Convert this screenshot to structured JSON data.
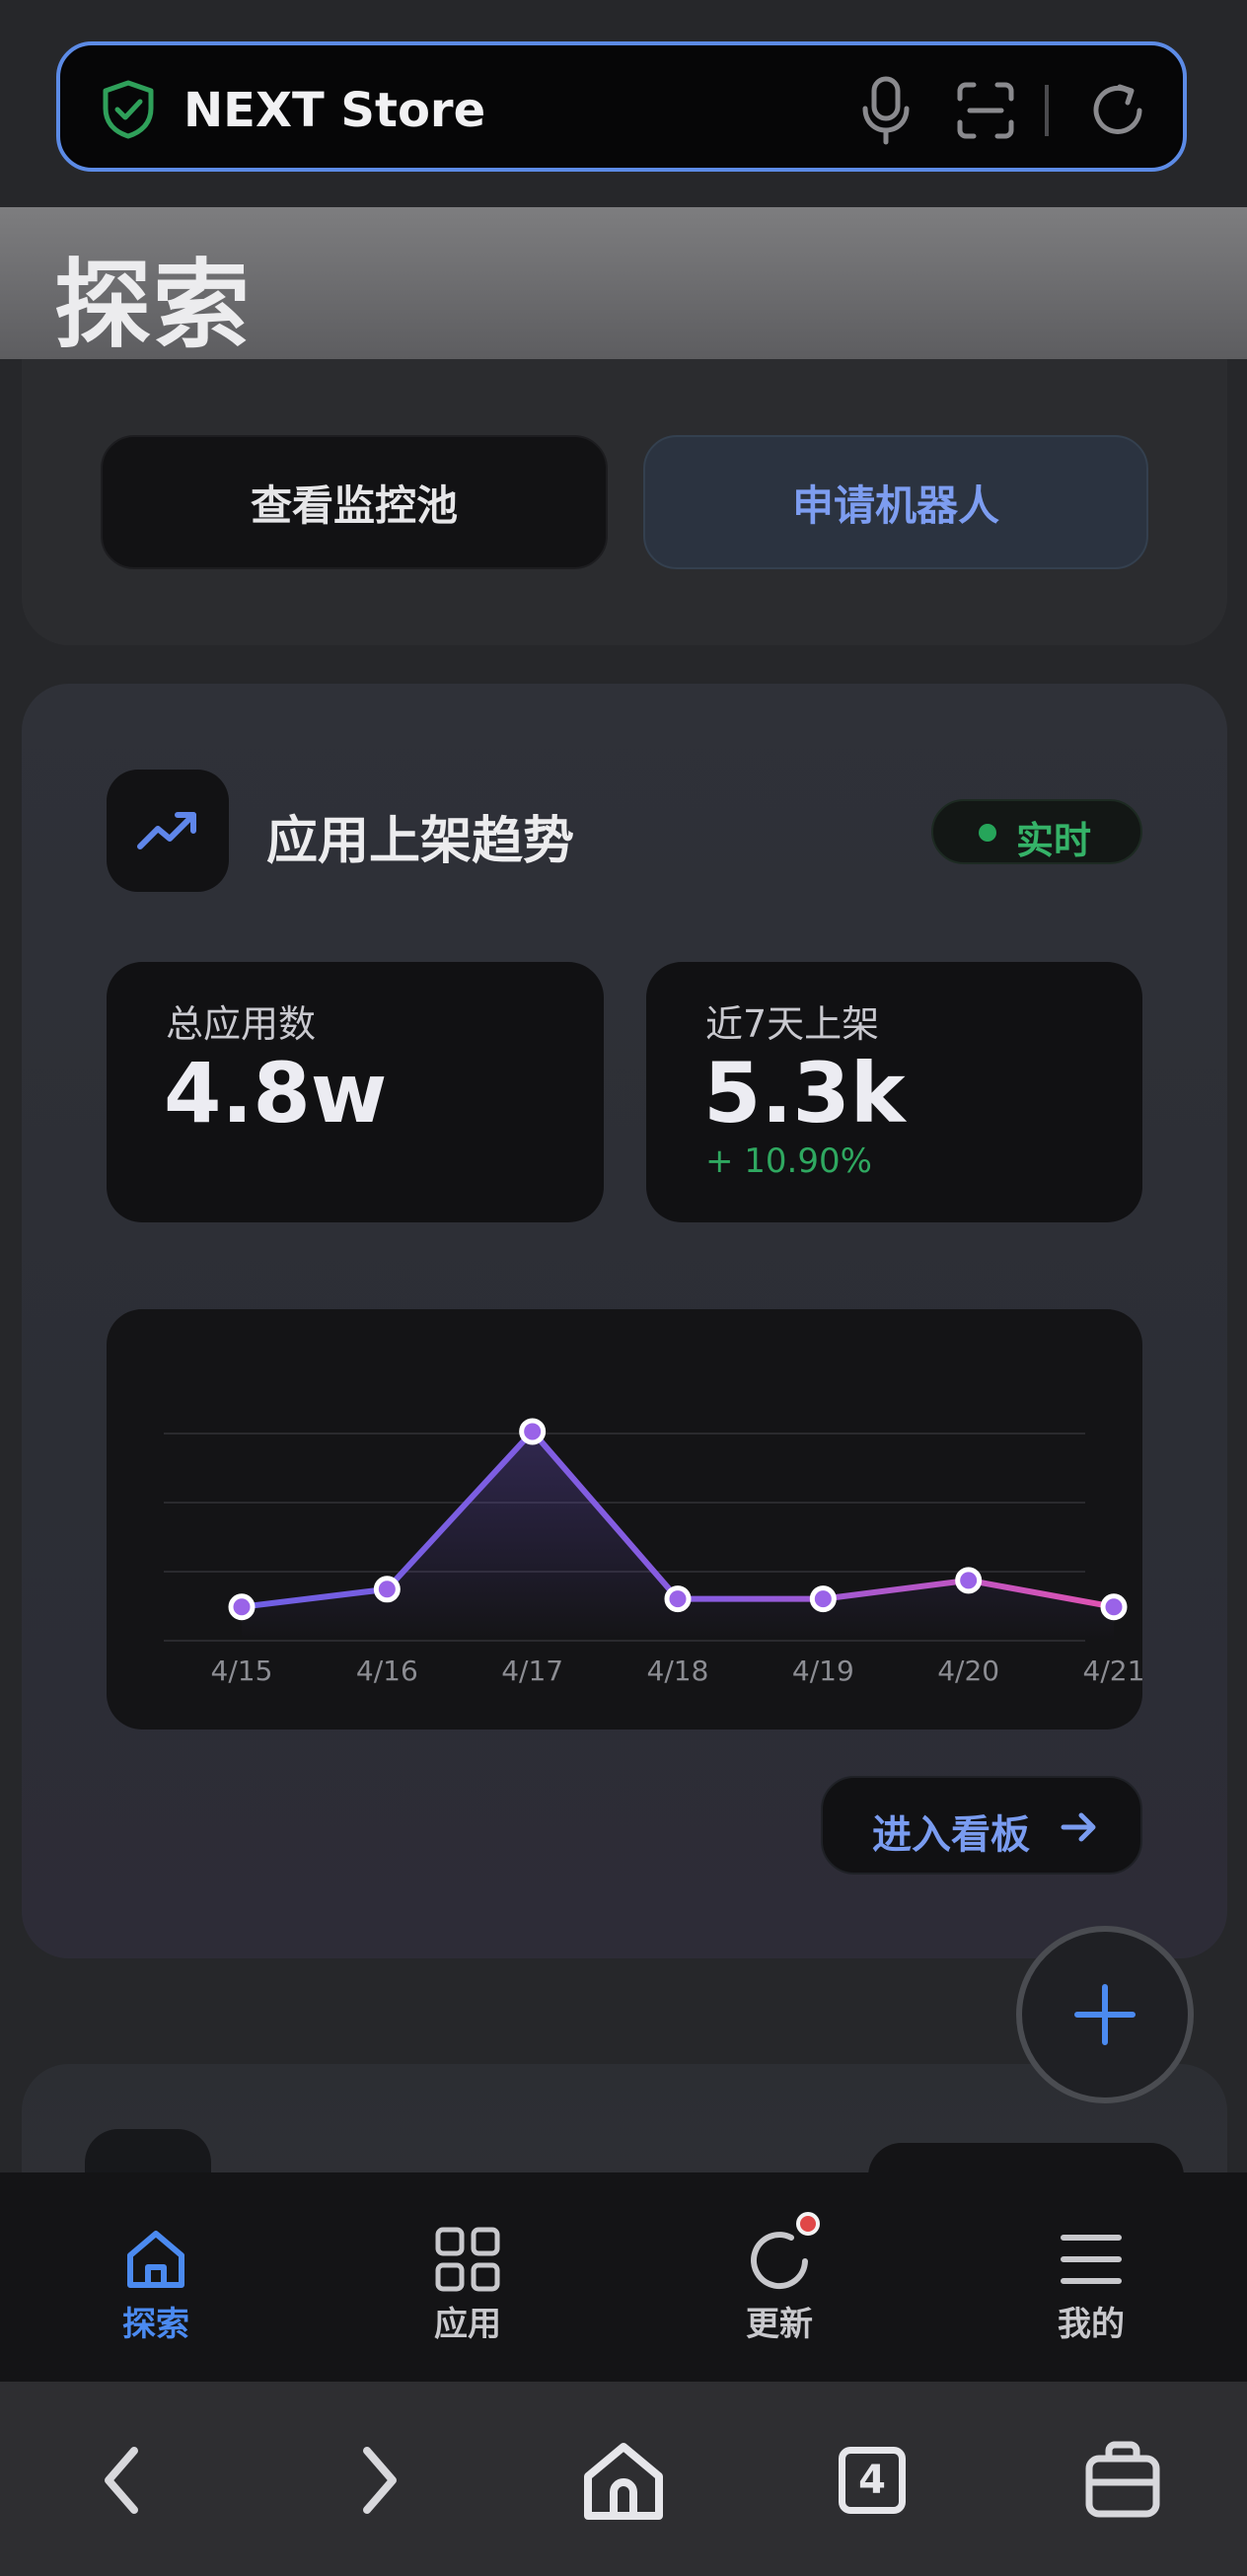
{
  "browser": {
    "title": "NEXT Store",
    "shield_icon": "shield-check-icon",
    "mic_icon": "microphone-icon",
    "scan_icon": "scan-icon",
    "reload_icon": "reload-icon"
  },
  "page": {
    "title": "探索"
  },
  "actions": {
    "monitor_label": "查看监控池",
    "robot_label": "申请机器人"
  },
  "trend_card": {
    "title": "应用上架趋势",
    "live_label": "实时",
    "total": {
      "label": "总应用数",
      "value": "4.8w"
    },
    "week": {
      "label": "近7天上架",
      "value": "5.3k",
      "change": "+ 10.90%"
    },
    "dashboard_label": "进入看板",
    "colors": {
      "accent": "#7a9cf0",
      "live": "#35b368",
      "line_start": "#7b5be6",
      "line_end": "#e056b5"
    }
  },
  "chart_data": {
    "type": "line",
    "x": [
      "4/15",
      "4/16",
      "4/17",
      "4/18",
      "4/19",
      "4/20",
      "4/21"
    ],
    "series": [
      {
        "values": [
          420,
          640,
          2600,
          520,
          520,
          750,
          420
        ]
      }
    ],
    "ylim": [
      0,
      3200
    ],
    "grid": true
  },
  "tabs": [
    {
      "label": "探索",
      "icon": "home-icon",
      "active": true
    },
    {
      "label": "应用",
      "icon": "apps-grid-icon",
      "active": false
    },
    {
      "label": "更新",
      "icon": "update-icon",
      "active": false,
      "badge": true
    },
    {
      "label": "我的",
      "icon": "menu-icon",
      "active": false
    }
  ],
  "system_nav": {
    "tab_count": "4",
    "icons": [
      "back-icon",
      "forward-icon",
      "home-icon",
      "tabs-icon",
      "bag-icon"
    ]
  }
}
